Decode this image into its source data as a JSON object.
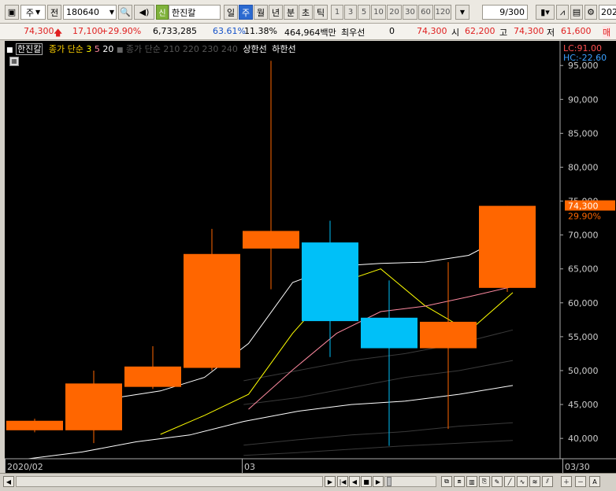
{
  "toolbar": {
    "period_type": "주",
    "period_mode": "전",
    "stock_code": "180640",
    "stock_name": "한진칼",
    "badge": "신",
    "period_tabs": [
      "일",
      "주",
      "월",
      "년",
      "분",
      "초",
      "틱"
    ],
    "active_tab": "주",
    "interval_buttons": [
      "1",
      "3",
      "5",
      "10",
      "20",
      "30",
      "60",
      "120"
    ],
    "count": "9/300",
    "date_partial": "2020"
  },
  "infobar": {
    "price": "74,300",
    "change": "17,100",
    "change_pct": "+29.90%",
    "volume": "6,733,285",
    "pct1": "63.61%",
    "pct2": "11.38%",
    "amount": "464,964백만",
    "priority_label": "최우선",
    "priority_value": "0",
    "current": "74,300",
    "open_label": "시",
    "open": "62,200",
    "high_label": "고",
    "high": "74,300",
    "low_label": "저",
    "low": "61,600",
    "extra": "매"
  },
  "legend": {
    "name": "한진칼",
    "ma_label": "종가 단순",
    "ma_periods": [
      "3",
      "5",
      "20"
    ],
    "ma_label2": "종가 단순",
    "ma_periods2": [
      "210",
      "220",
      "230",
      "240"
    ],
    "upper_limit": "상한선",
    "lower_limit": "하한선"
  },
  "colors": {
    "up": "#ff6600",
    "down": "#00c0f8",
    "ma3": "#ffff00",
    "ma5": "#ff8aa0",
    "ma20": "#ffffff",
    "upper": "#ffffff",
    "faint": "#3a3a3a"
  },
  "overlay": {
    "lc": "LC:91.00",
    "hc": "HC:-22.60",
    "price_tag": "74,300",
    "pct_tag": "29.90%"
  },
  "chart_data": {
    "type": "candlestick",
    "x_labels": [
      "2020/02",
      "03",
      "03/30"
    ],
    "y_ticks": [
      "95,000",
      "90,000",
      "85,000",
      "80,000",
      "75,000",
      "70,000",
      "65,000",
      "60,000",
      "55,000",
      "50,000",
      "45,000",
      "40,000"
    ],
    "ylim": [
      37000,
      97000
    ],
    "candles": [
      {
        "open": 41200,
        "close": 42600,
        "high": 42900,
        "low": 40900
      },
      {
        "open": 41200,
        "close": 48100,
        "high": 50000,
        "low": 39300
      },
      {
        "open": 47600,
        "close": 50600,
        "high": 53600,
        "low": 47300
      },
      {
        "open": 50400,
        "close": 67200,
        "high": 70900,
        "low": 50000
      },
      {
        "open": 68000,
        "close": 70600,
        "high": 95700,
        "low": 62000
      },
      {
        "open": 68900,
        "close": 57300,
        "high": 72100,
        "low": 52000
      },
      {
        "open": 57800,
        "close": 53300,
        "high": 63300,
        "low": 38900
      },
      {
        "open": 53300,
        "close": 57200,
        "high": 66000,
        "low": 41400
      },
      {
        "open": 62200,
        "close": 74300,
        "high": 74300,
        "low": 61600
      }
    ],
    "series": [
      {
        "name": "3",
        "values": [
          null,
          null,
          null,
          40600,
          43400,
          46500,
          55500,
          62800,
          65000,
          59600,
          55800,
          61500
        ]
      },
      {
        "name": "5",
        "values": [
          null,
          null,
          null,
          null,
          null,
          44300,
          50100,
          55500,
          58700,
          59500,
          60900,
          62400
        ]
      },
      {
        "name": "20",
        "values": [
          null,
          null,
          46000,
          47000,
          49000,
          54000,
          63000,
          65400,
          65800,
          66000,
          67000,
          70400
        ]
      },
      {
        "name": "upper",
        "values": [
          37000,
          38000,
          39500,
          40500,
          42500,
          44000,
          45000,
          45500,
          46500,
          47800
        ]
      },
      {
        "name": "210",
        "values": [
          null,
          null,
          null,
          null,
          48500,
          50000,
          51500,
          52500,
          54000,
          56000
        ]
      },
      {
        "name": "220",
        "values": [
          null,
          null,
          null,
          null,
          45000,
          46000,
          47500,
          49000,
          50000,
          51500
        ]
      },
      {
        "name": "230",
        "values": [
          null,
          null,
          null,
          null,
          39000,
          39800,
          40500,
          41000,
          41800,
          42300
        ]
      },
      {
        "name": "240",
        "values": [
          null,
          null,
          null,
          null,
          37500,
          37900,
          38400,
          38900,
          39300,
          39700
        ]
      }
    ]
  }
}
